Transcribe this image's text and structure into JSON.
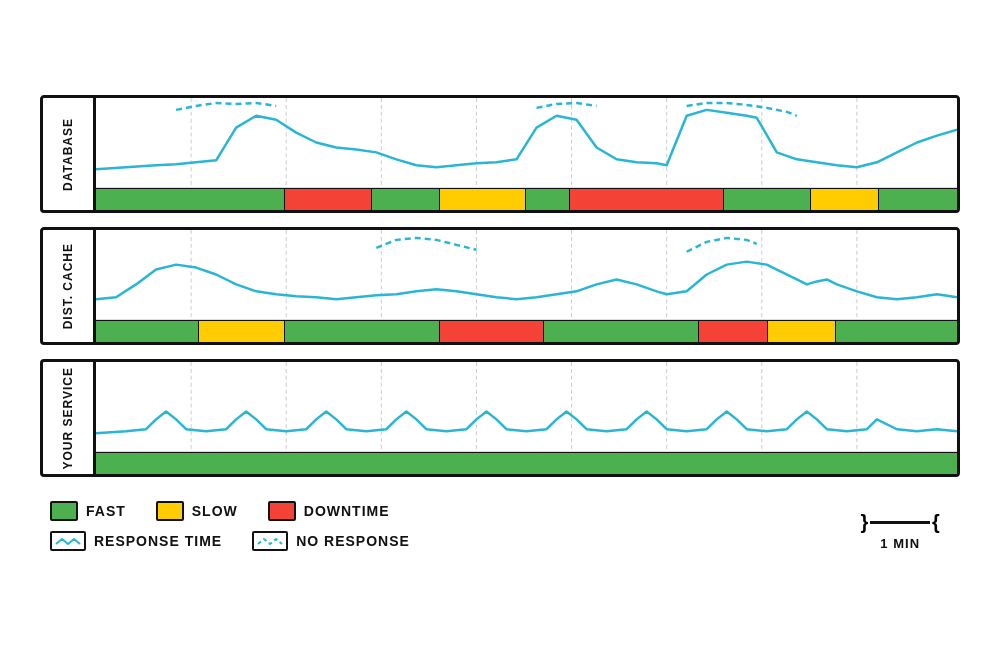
{
  "charts": [
    {
      "id": "database",
      "label": "DATABASE",
      "statusSegments": [
        {
          "color": "#4caf50",
          "width": 22
        },
        {
          "color": "#f44336",
          "width": 10
        },
        {
          "color": "#4caf50",
          "width": 8
        },
        {
          "color": "#ffcc00",
          "width": 10
        },
        {
          "color": "#4caf50",
          "width": 5
        },
        {
          "color": "#f44336",
          "width": 18
        },
        {
          "color": "#4caf50",
          "width": 10
        },
        {
          "color": "#ffcc00",
          "width": 8
        },
        {
          "color": "#4caf50",
          "width": 9
        }
      ]
    },
    {
      "id": "dist-cache",
      "label": "DIST. CACHE",
      "statusSegments": [
        {
          "color": "#4caf50",
          "width": 12
        },
        {
          "color": "#ffcc00",
          "width": 10
        },
        {
          "color": "#4caf50",
          "width": 18
        },
        {
          "color": "#f44336",
          "width": 12
        },
        {
          "color": "#4caf50",
          "width": 18
        },
        {
          "color": "#f44336",
          "width": 8
        },
        {
          "color": "#ffcc00",
          "width": 8
        },
        {
          "color": "#4caf50",
          "width": 14
        }
      ]
    },
    {
      "id": "your-service",
      "label": "YOUR SERVICE",
      "statusSegments": [
        {
          "color": "#4caf50",
          "width": 100
        }
      ]
    }
  ],
  "legend": {
    "row1": [
      {
        "type": "box",
        "color": "#4caf50",
        "label": "FAST"
      },
      {
        "type": "box",
        "color": "#ffcc00",
        "label": "SLOW"
      },
      {
        "type": "box",
        "color": "#f44336",
        "label": "DOWNTIME"
      }
    ],
    "row2": [
      {
        "type": "line",
        "style": "solid",
        "label": "RESPONSE TIME"
      },
      {
        "type": "line",
        "style": "dashed",
        "label": "NO RESPONSE"
      }
    ]
  },
  "timeLabel": "1 MIN"
}
